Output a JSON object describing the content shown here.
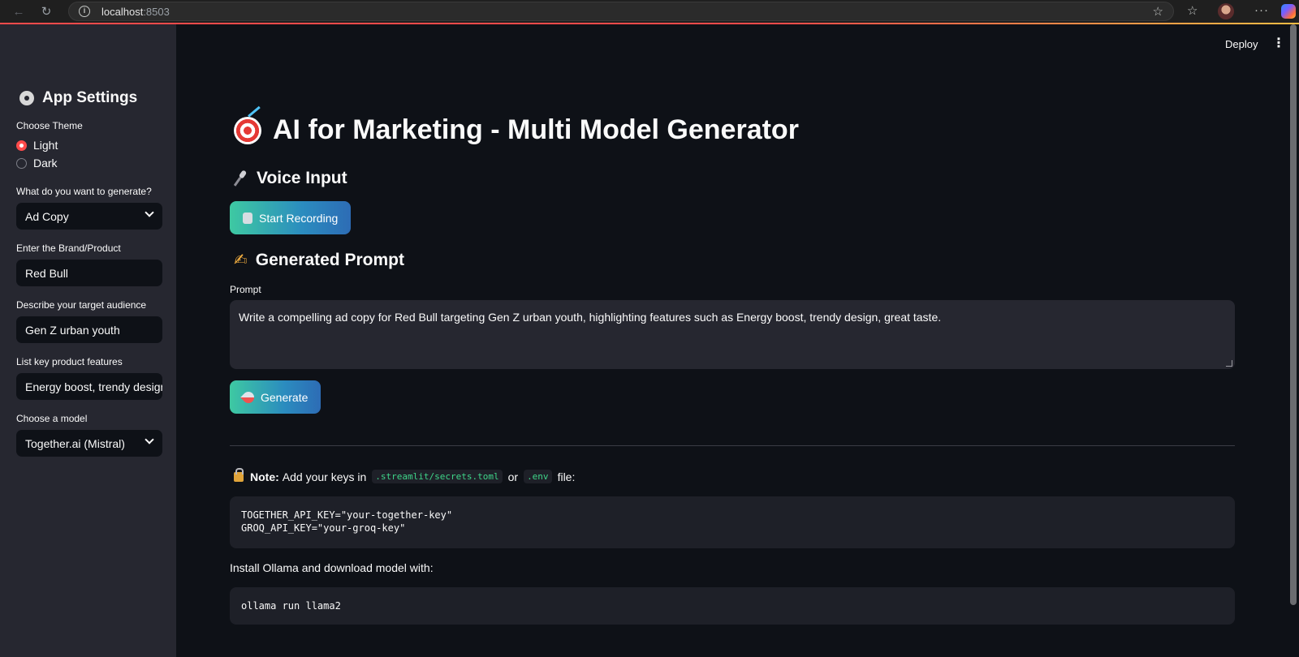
{
  "browser": {
    "url_host": "localhost",
    "url_port": ":8503"
  },
  "sidebar": {
    "title": "App Settings",
    "theme_label": "Choose Theme",
    "theme_options": [
      "Light",
      "Dark"
    ],
    "theme_selected": "Light",
    "generate_label": "What do you want to generate?",
    "generate_value": "Ad Copy",
    "brand_label": "Enter the Brand/Product",
    "brand_value": "Red Bull",
    "audience_label": "Describe your target audience",
    "audience_value": "Gen Z urban youth",
    "features_label": "List key product features",
    "features_value": "Energy boost, trendy design,",
    "model_label": "Choose a model",
    "model_value": "Together.ai (Mistral)"
  },
  "header": {
    "deploy_label": "Deploy"
  },
  "main": {
    "title": "AI for Marketing - Multi Model Generator",
    "voice_heading": "Voice Input",
    "record_button": "Start Recording",
    "prompt_heading": "Generated Prompt",
    "prompt_label": "Prompt",
    "prompt_value": "Write a compelling ad copy for Red Bull targeting Gen Z urban youth, highlighting features such as Energy boost, trendy design, great taste.",
    "generate_button": "Generate",
    "note_bold": "Note:",
    "note_text_1": "Add your keys in",
    "note_code_1": ".streamlit/secrets.toml",
    "note_or": "or",
    "note_code_2": ".env",
    "note_text_2": "file:",
    "keys_code": "TOGETHER_API_KEY=\"your-together-key\"\nGROQ_API_KEY=\"your-groq-key\"",
    "ollama_text": "Install Ollama and download model with:",
    "ollama_code": "ollama run llama2"
  },
  "colors": {
    "accent": "#ff4b4b",
    "background": "#0e1117",
    "sidebar": "#262730",
    "button_gradient_start": "#3ec9a2",
    "button_gradient_end": "#2d6cb5",
    "inline_code": "#3fd68a"
  },
  "icons": {
    "title": "target-dart-icon",
    "voice": "microphone-icon",
    "prompt": "writing-hand-icon",
    "record": "microphone-icon",
    "generate": "rocket-icon",
    "note": "lock-key-icon",
    "settings": "gear-icon"
  }
}
